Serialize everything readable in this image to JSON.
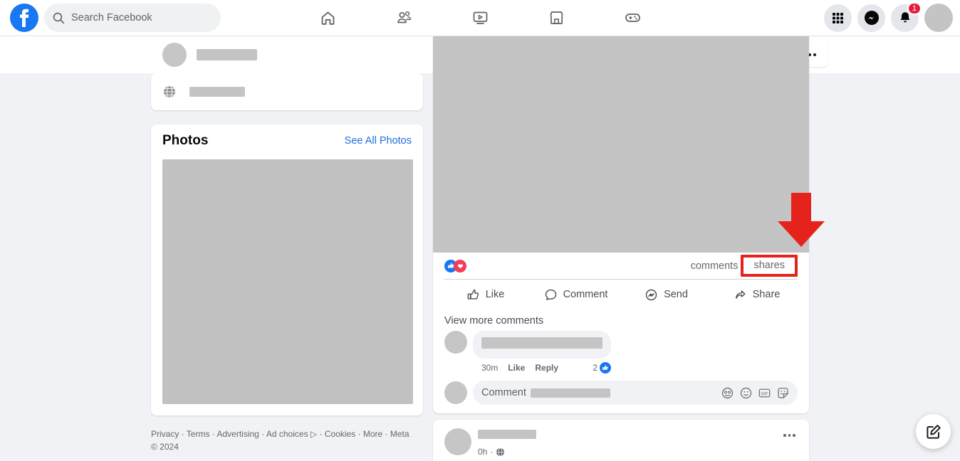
{
  "topbar": {
    "logo_icon": "facebook-logo-icon",
    "search": {
      "placeholder": "Search Facebook",
      "value": "",
      "icon": "search-icon"
    },
    "nav": [
      {
        "name": "home",
        "icon": "home-icon",
        "active": false
      },
      {
        "name": "friends",
        "icon": "friends-icon",
        "active": false
      },
      {
        "name": "video",
        "icon": "video-icon",
        "active": false
      },
      {
        "name": "marketplace",
        "icon": "marketplace-icon",
        "active": false
      },
      {
        "name": "gaming",
        "icon": "gaming-icon",
        "active": false
      }
    ],
    "right": [
      {
        "name": "menu-grid",
        "icon": "grid-menu-icon"
      },
      {
        "name": "messenger",
        "icon": "messenger-icon"
      },
      {
        "name": "notifications",
        "icon": "bell-icon",
        "badge": "1"
      },
      {
        "name": "account",
        "icon": "avatar"
      }
    ]
  },
  "profile_strip": {
    "name_redacted": true,
    "more_button_icon": "ellipsis-icon"
  },
  "left_column": {
    "intro_card": {
      "icon": "globe-icon",
      "value_redacted": true
    },
    "photos_card": {
      "title": "Photos",
      "see_all_label": "See All Photos",
      "grid_placeholder": true
    },
    "footer": {
      "links": [
        "Privacy",
        "Terms",
        "Advertising",
        "Ad choices",
        "Cookies",
        "More"
      ],
      "ad_choices_icon": "ad-choices-icon",
      "copyright": "Meta © 2024",
      "separator": "·"
    }
  },
  "post": {
    "media_placeholder": true,
    "reactions": {
      "icons": [
        "like-reaction-icon",
        "love-reaction-icon"
      ],
      "count": ""
    },
    "comments_label": "comments",
    "shares_label": "shares",
    "shares_highlighted": true,
    "actions": [
      {
        "label": "Like",
        "icon": "thumbs-up-icon"
      },
      {
        "label": "Comment",
        "icon": "comment-bubble-icon"
      },
      {
        "label": "Send",
        "icon": "send-icon"
      },
      {
        "label": "Share",
        "icon": "share-arrow-icon"
      }
    ],
    "view_more_comments": "View more comments",
    "comment": {
      "author_redacted": true,
      "text_redacted": true,
      "time": "30m",
      "like_label": "Like",
      "reply_label": "Reply",
      "like_count": "2",
      "like_badge_icon": "like-reaction-icon"
    },
    "composer": {
      "label": "Comment",
      "value_redacted": true,
      "icons": [
        "emoji-avatar-icon",
        "smiley-icon",
        "gif-icon",
        "sticker-icon"
      ]
    }
  },
  "next_post": {
    "author_redacted": true,
    "time": "0h",
    "audience_icon": "globe-icon",
    "separator": "·",
    "more_icon": "ellipsis-icon"
  },
  "annotation": {
    "arrow_color": "#e5231c",
    "highlight_color": "#e5231c",
    "arrow_icon": "down-arrow-annotation"
  },
  "fab": {
    "icon": "compose-icon"
  }
}
